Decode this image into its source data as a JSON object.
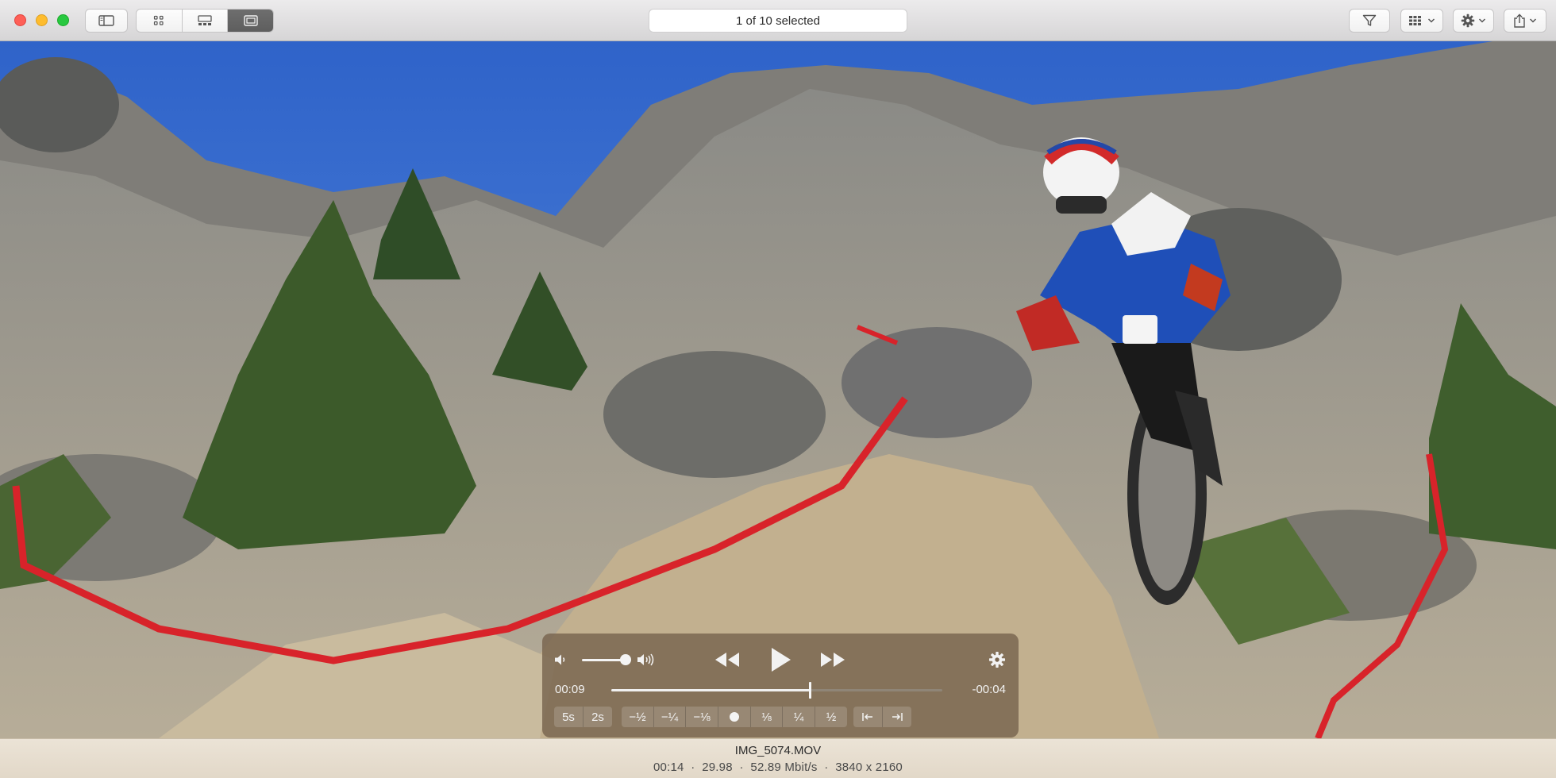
{
  "window": {
    "title": "1 of 10 selected"
  },
  "toolbar": {
    "sidebar_icon": "sidebar-icon",
    "view_modes": [
      {
        "name": "grid-view",
        "icon": "grid-icon",
        "active": false
      },
      {
        "name": "filmstrip-view",
        "icon": "filmstrip-icon",
        "active": false
      },
      {
        "name": "single-view",
        "icon": "single-image-icon",
        "active": true
      }
    ],
    "filter_icon": "filter-icon",
    "thumbnail_size_icon": "grid-icon",
    "action_icon": "gear-icon",
    "share_icon": "share-icon"
  },
  "video": {
    "scene": "mountain-bike-trail"
  },
  "player": {
    "elapsed": "00:09",
    "remaining": "-00:04",
    "progress_fraction": 0.6,
    "volume_fraction": 1.0,
    "skip_buttons": [
      "5s",
      "2s"
    ],
    "rate_buttons": [
      "−½",
      "−¼",
      "−⅛",
      "⅛",
      "¼",
      "½"
    ],
    "colors": {
      "hud_background": "#786450",
      "foreground": "#f2f2f2"
    }
  },
  "info": {
    "filename": "IMG_5074.MOV",
    "meta": "00:14  ·  29.98  ·  52.89 Mbit/s  ·  3840 x 2160"
  }
}
